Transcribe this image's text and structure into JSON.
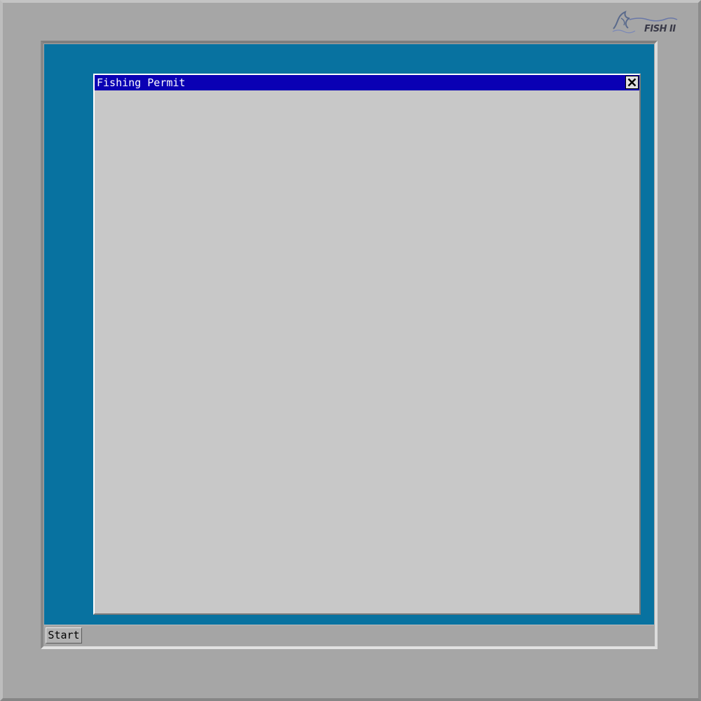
{
  "logo": {
    "text": "FISH II",
    "icon": "fish-logo-icon"
  },
  "window": {
    "title": "Fishing Permit",
    "close_icon": "close-icon"
  },
  "taskbar": {
    "start_label": "Start"
  },
  "colors": {
    "desktop": "#0872a0",
    "titlebar": "#0a00b4",
    "window_body": "#c8c8c8",
    "bezel": "#a6a6a6"
  }
}
